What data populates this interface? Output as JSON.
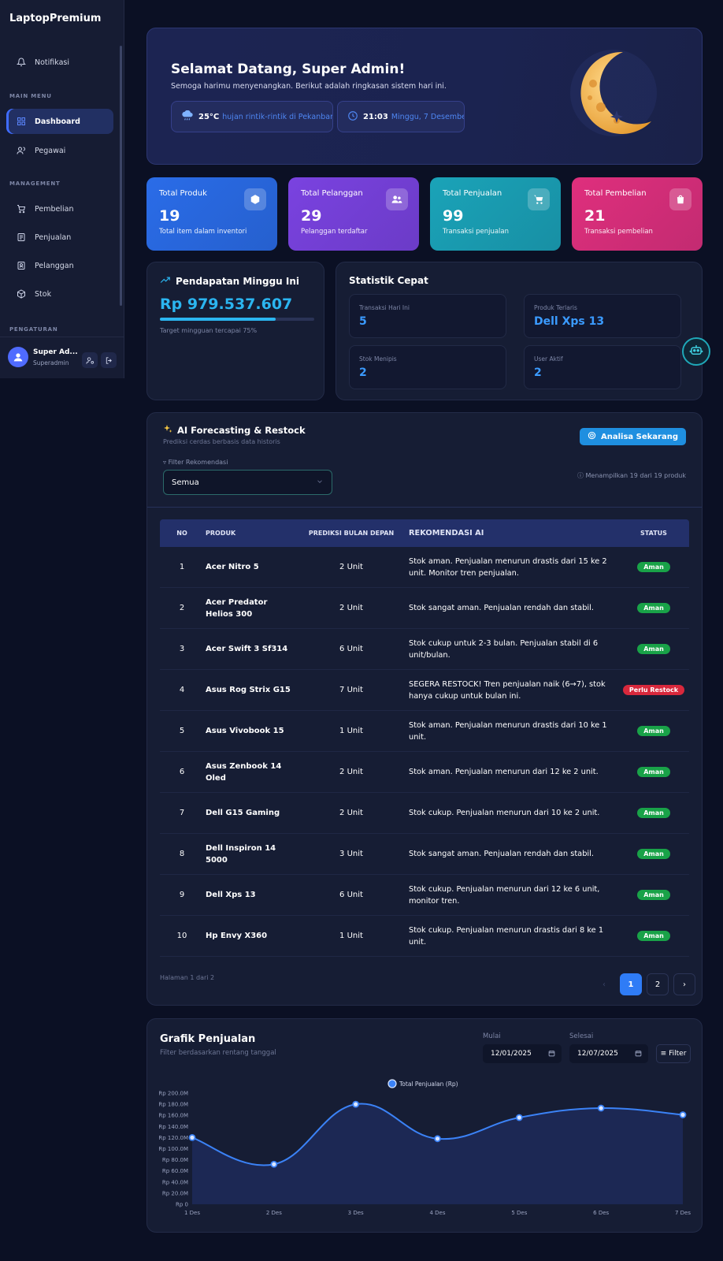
{
  "sidebar": {
    "brand": "LaptopPremium",
    "notifications": "Notifikasi",
    "section_main": "MAIN MENU",
    "dashboard": "Dashboard",
    "employees": "Pegawai",
    "section_management": "MANAGEMENT",
    "purchases": "Pembelian",
    "sales": "Penjualan",
    "customers": "Pelanggan",
    "stock": "Stok",
    "section_settings": "PENGATURAN",
    "user_name": "Super Ad...",
    "user_role": "Superadmin"
  },
  "welcome": {
    "title": "Selamat Datang, Super Admin!",
    "subtitle": "Semoga harimu menyenangkan. Berikut adalah ringkasan sistem hari ini.",
    "temp": "25°C",
    "weather": "hujan rintik-rintik di Pekanbaru",
    "time": "21:03",
    "date": "Minggu, 7 Desember"
  },
  "stats": [
    {
      "title": "Total Produk",
      "value": "19",
      "desc": "Total item dalam inventori",
      "color": "#2a6ce8"
    },
    {
      "title": "Total Pelanggan",
      "value": "29",
      "desc": "Pelanggan terdaftar",
      "color": "#7a42e0"
    },
    {
      "title": "Total Penjualan",
      "value": "99",
      "desc": "Transaksi penjualan",
      "color": "#1aa3b8"
    },
    {
      "title": "Total Pembelian",
      "value": "21",
      "desc": "Transaksi pembelian",
      "color": "#df2f7d"
    }
  ],
  "income": {
    "title": "Pendapatan Minggu Ini",
    "amount": "Rp 979.537.607",
    "progress": 0.75,
    "note": "Target mingguan tercapai 75%"
  },
  "quick": {
    "title": "Statistik Cepat",
    "items": [
      {
        "label": "Transaksi Hari Ini",
        "value": "5"
      },
      {
        "label": "Produk Terlaris",
        "value": "Dell Xps 13"
      },
      {
        "label": "Stok Menipis",
        "value": "2"
      },
      {
        "label": "User Aktif",
        "value": "2"
      }
    ]
  },
  "ai": {
    "title": "AI Forecasting & Restock",
    "subtitle": "Prediksi cerdas berbasis data historis",
    "analyze_button": "Analisa Sekarang",
    "filter_label": "Filter Rekomendasi",
    "filter_value": "Semua",
    "showing": "Menampilkan 19 dari 19 produk",
    "headers": [
      "NO",
      "PRODUK",
      "PREDIKSI BULAN DEPAN",
      "REKOMENDASI AI",
      "STATUS"
    ],
    "rows": [
      {
        "no": "1",
        "product": "Acer Nitro 5",
        "pred": "2 Unit",
        "rec": "Stok aman. Penjualan menurun drastis dari 15 ke 2 unit. Monitor tren penjualan.",
        "status": "Aman",
        "warn": false
      },
      {
        "no": "2",
        "product": "Acer Predator Helios 300",
        "pred": "2 Unit",
        "rec": "Stok sangat aman. Penjualan rendah dan stabil.",
        "status": "Aman",
        "warn": false
      },
      {
        "no": "3",
        "product": "Acer Swift 3 Sf314",
        "pred": "6 Unit",
        "rec": "Stok cukup untuk 2-3 bulan. Penjualan stabil di 6 unit/bulan.",
        "status": "Aman",
        "warn": false
      },
      {
        "no": "4",
        "product": "Asus Rog Strix G15",
        "pred": "7 Unit",
        "rec": "SEGERA RESTOCK! Tren penjualan naik (6→7), stok hanya cukup untuk bulan ini.",
        "status": "Perlu Restock",
        "warn": true
      },
      {
        "no": "5",
        "product": "Asus Vivobook 15",
        "pred": "1 Unit",
        "rec": "Stok aman. Penjualan menurun drastis dari 10 ke 1 unit.",
        "status": "Aman",
        "warn": false
      },
      {
        "no": "6",
        "product": "Asus Zenbook 14 Oled",
        "pred": "2 Unit",
        "rec": "Stok aman. Penjualan menurun dari 12 ke 2 unit.",
        "status": "Aman",
        "warn": false
      },
      {
        "no": "7",
        "product": "Dell G15 Gaming",
        "pred": "2 Unit",
        "rec": "Stok cukup. Penjualan menurun dari 10 ke 2 unit.",
        "status": "Aman",
        "warn": false
      },
      {
        "no": "8",
        "product": "Dell Inspiron 14 5000",
        "pred": "3 Unit",
        "rec": "Stok sangat aman. Penjualan rendah dan stabil.",
        "status": "Aman",
        "warn": false
      },
      {
        "no": "9",
        "product": "Dell Xps 13",
        "pred": "6 Unit",
        "rec": "Stok cukup. Penjualan menurun dari 12 ke 6 unit, monitor tren.",
        "status": "Aman",
        "warn": false
      },
      {
        "no": "10",
        "product": "Hp Envy X360",
        "pred": "1 Unit",
        "rec": "Stok cukup. Penjualan menurun drastis dari 8 ke 1 unit.",
        "status": "Aman",
        "warn": false
      }
    ],
    "page_info": "Halaman 1 dari 2",
    "pages": [
      "1",
      "2"
    ]
  },
  "sales_chart": {
    "title": "Grafik Penjualan",
    "subtitle": "Filter berdasarkan rentang tanggal",
    "start_label": "Mulai",
    "start_value": "12/01/2025",
    "end_label": "Selesai",
    "end_value": "12/07/2025",
    "filter_button": "Filter"
  },
  "chart_data": {
    "type": "area",
    "categories": [
      "1 Des",
      "2 Des",
      "3 Des",
      "4 Des",
      "5 Des",
      "6 Des",
      "7 Des"
    ],
    "series": [
      {
        "name": "Total Penjualan (Rp)",
        "values": [
          120,
          72,
          180,
          118,
          156,
          173,
          161
        ]
      }
    ],
    "ylim": [
      0,
      200
    ],
    "yticks": [
      "Rp 0",
      "Rp 20.0M",
      "Rp 40.0M",
      "Rp 60.0M",
      "Rp 80.0M",
      "Rp 100.0M",
      "Rp 120.0M",
      "Rp 140.0M",
      "Rp 160.0M",
      "Rp 180.0M",
      "Rp 200.0M"
    ],
    "legend": "top-center",
    "color": "#3b82f6"
  }
}
